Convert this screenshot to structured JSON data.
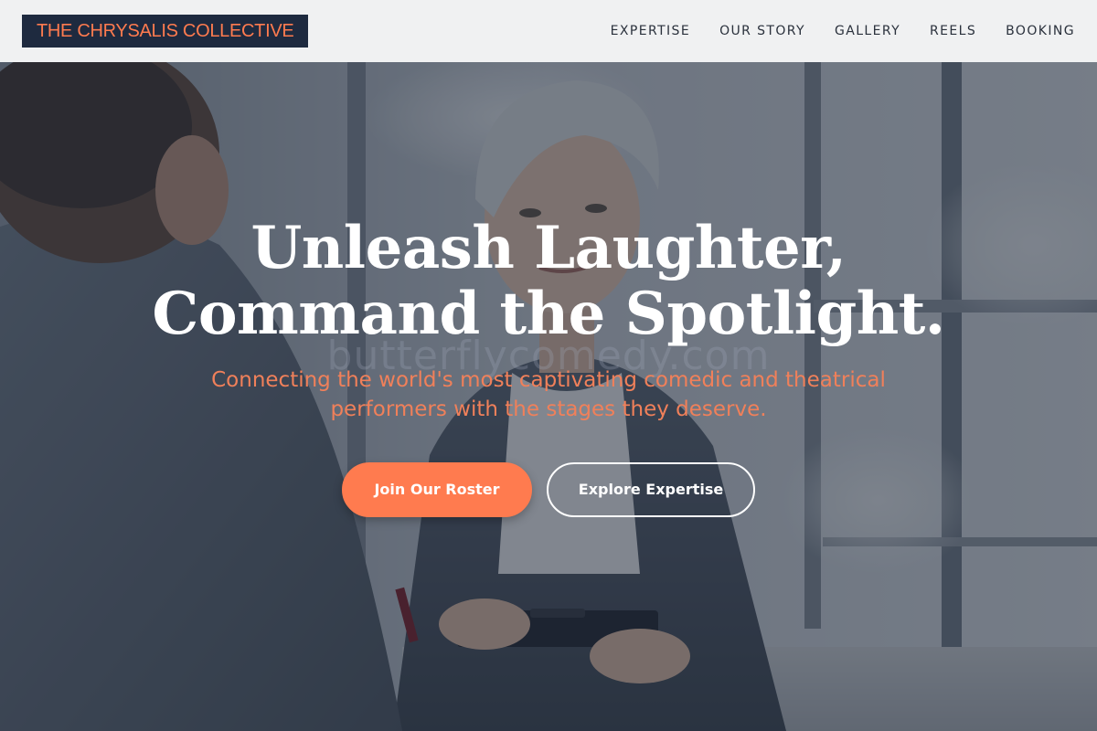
{
  "header": {
    "logo_text": "THE CHRYSALIS COLLECTIVE",
    "nav": [
      {
        "label": "EXPERTISE"
      },
      {
        "label": "OUR STORY"
      },
      {
        "label": "GALLERY"
      },
      {
        "label": "REELS"
      },
      {
        "label": "BOOKING"
      }
    ]
  },
  "hero": {
    "headline_line1": "Unleash Laughter,",
    "headline_line2": "Command the Spotlight.",
    "watermark": "butterflycomedy.com",
    "subtitle": "Connecting the world's most captivating comedic and theatrical performers with the stages they deserve.",
    "primary_button": "Join Our Roster",
    "secondary_button": "Explore Expertise"
  },
  "colors": {
    "accent": "#ff7b4f",
    "logo_background": "#1e2a3f",
    "header_background": "#f0f1f2",
    "nav_text": "#2a313c"
  }
}
